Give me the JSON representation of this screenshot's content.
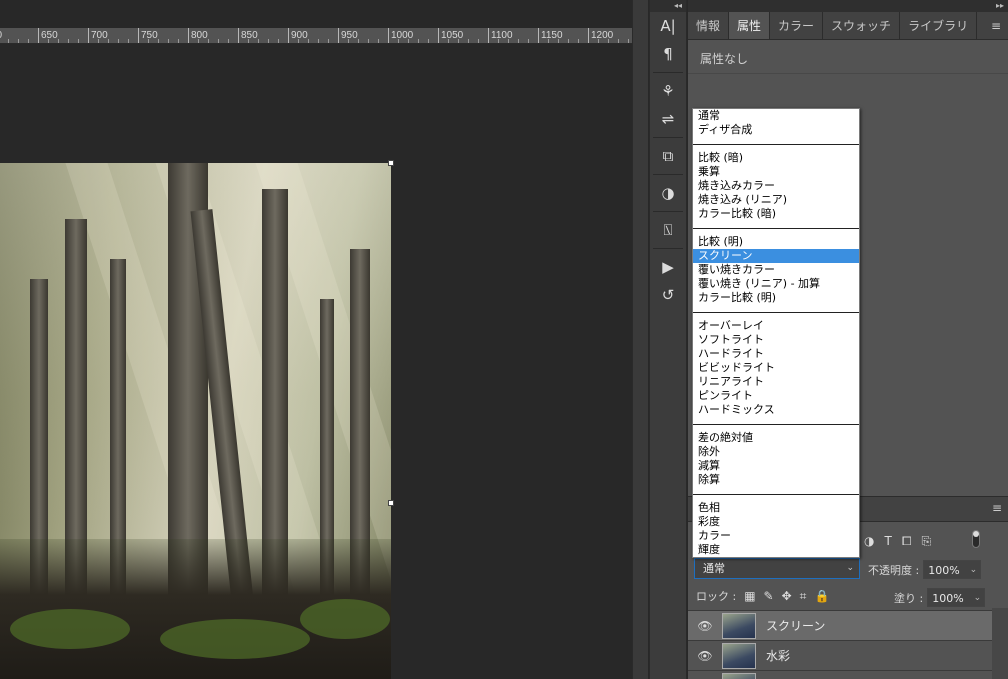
{
  "ruler": {
    "labels": [
      "00",
      "650",
      "700",
      "750",
      "800",
      "850",
      "900",
      "950",
      "1000",
      "1050",
      "1100",
      "1150",
      "1200"
    ]
  },
  "toolstrip": {
    "collapse_glyph": "◂◂",
    "tools": [
      {
        "name": "character-icon",
        "glyph": "A|"
      },
      {
        "name": "paragraph-icon",
        "glyph": "¶"
      },
      {
        "name": "brush-settings-icon",
        "glyph": "⚘"
      },
      {
        "name": "brush-presets-icon",
        "glyph": "⇌"
      },
      {
        "name": "clone-source-icon",
        "glyph": "⧉"
      },
      {
        "name": "adjustments-icon",
        "glyph": "◑"
      },
      {
        "name": "glyphs-icon",
        "glyph": "⍂"
      },
      {
        "name": "actions-play-icon",
        "glyph": "▶"
      },
      {
        "name": "history-icon",
        "glyph": "↺"
      }
    ]
  },
  "panel": {
    "collapse_glyph": "▸▸",
    "tabs": [
      "情報",
      "属性",
      "カラー",
      "スウォッチ",
      "ライブラリ"
    ],
    "active_tab": 1,
    "menu_glyph": "≡",
    "properties_text": "属性なし"
  },
  "blend_modes": {
    "groups": [
      [
        "通常",
        "ディザ合成"
      ],
      [
        "比較 (暗)",
        "乗算",
        "焼き込みカラー",
        "焼き込み (リニア)",
        "カラー比較 (暗)"
      ],
      [
        "比較 (明)",
        "スクリーン",
        "覆い焼きカラー",
        "覆い焼き (リニア) - 加算",
        "カラー比較 (明)"
      ],
      [
        "オーバーレイ",
        "ソフトライト",
        "ハードライト",
        "ビビッドライト",
        "リニアライト",
        "ピンライト",
        "ハードミックス"
      ],
      [
        "差の絶対値",
        "除外",
        "減算",
        "除算"
      ],
      [
        "色相",
        "彩度",
        "カラー",
        "輝度"
      ]
    ],
    "highlighted": "スクリーン",
    "selected_value": "通常"
  },
  "layers": {
    "menu_glyph": "≡",
    "filter_icons": [
      {
        "name": "adjustment-filter-icon",
        "glyph": "◑"
      },
      {
        "name": "type-filter-icon",
        "glyph": "T"
      },
      {
        "name": "shape-filter-icon",
        "glyph": "⧠"
      },
      {
        "name": "smart-object-filter-icon",
        "glyph": "⎘"
      }
    ],
    "opacity_label": "不透明度 :",
    "opacity_value": "100%",
    "lock_label": "ロック :",
    "lock_icons": [
      {
        "name": "lock-transparent-icon",
        "glyph": "▦"
      },
      {
        "name": "lock-image-icon",
        "glyph": "✎"
      },
      {
        "name": "lock-position-icon",
        "glyph": "✥"
      },
      {
        "name": "lock-artboard-icon",
        "glyph": "⌗"
      },
      {
        "name": "lock-all-icon",
        "glyph": "🔒"
      }
    ],
    "fill_label": "塗り :",
    "fill_value": "100%",
    "items": [
      {
        "name": "スクリーン",
        "selected": true
      },
      {
        "name": "水彩",
        "selected": false
      },
      {
        "name": "",
        "selected": false
      }
    ],
    "eye_glyph": "👁",
    "chevron_glyph": "⌄"
  }
}
